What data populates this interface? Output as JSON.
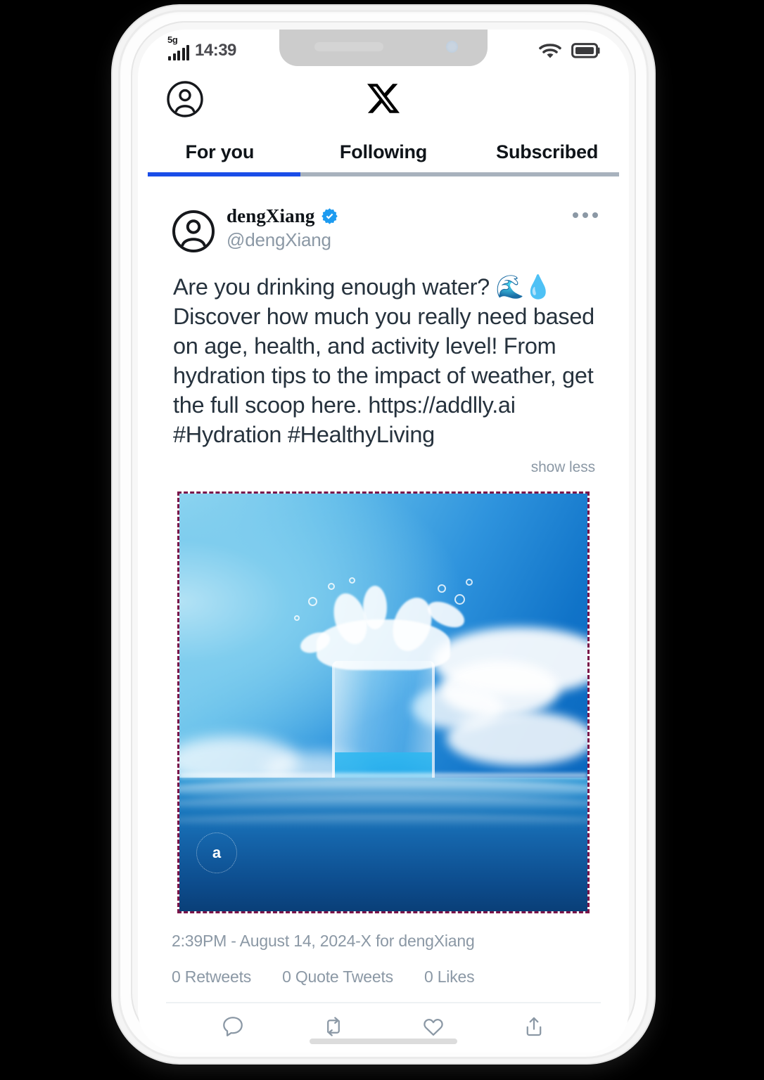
{
  "status_bar": {
    "network_label": "5g",
    "signal_icon": "signal-bars-icon",
    "time": "14:39",
    "wifi_icon": "wifi-icon",
    "battery_icon": "battery-icon"
  },
  "app_header": {
    "profile_icon": "profile-avatar-icon",
    "logo_icon": "x-logo-icon",
    "app_name": "X"
  },
  "tabs": [
    {
      "label": "For you",
      "active": true
    },
    {
      "label": "Following",
      "active": false
    },
    {
      "label": "Subscribed",
      "active": false
    }
  ],
  "tweet": {
    "avatar_icon": "user-avatar-icon",
    "display_name": "dengXiang",
    "verified_icon": "verified-badge-icon",
    "verified_color": "#1d9bf0",
    "handle": "@dengXiang",
    "more_icon": "more-options-icon",
    "text_line_1": "Are you drinking enough water? ",
    "emoji_wave": "🌊",
    "emoji_drop": "💧",
    "text_line_2": " Discover how much you really need based on age, health, and activity level! From hydration tips to the impact of weather, get the full scoop here. https://addlly.ai #Hydration #HealthyLiving",
    "show_less_label": "show less",
    "media": {
      "alt": "glass of water splashing above ocean surface under blue sky",
      "border_style": "dashed",
      "border_color": "#7a1449",
      "watermark_letter": "a",
      "watermark_icon": "ai-generated-badge-icon"
    },
    "timestamp": "2:39PM - August 14, 2024-X for dengXiang",
    "counts": [
      {
        "label": "0 Retweets"
      },
      {
        "label": "0 Quote Tweets"
      },
      {
        "label": "0 Likes"
      }
    ],
    "actions": [
      {
        "icon": "reply-icon"
      },
      {
        "icon": "retweet-icon"
      },
      {
        "icon": "like-heart-icon"
      },
      {
        "icon": "share-icon"
      }
    ]
  },
  "theme": {
    "accent_blue": "#1a4de8",
    "verified_blue": "#1d9bf0",
    "text_dark": "#26323d",
    "text_muted": "#8b98a5",
    "background": "#000000"
  }
}
